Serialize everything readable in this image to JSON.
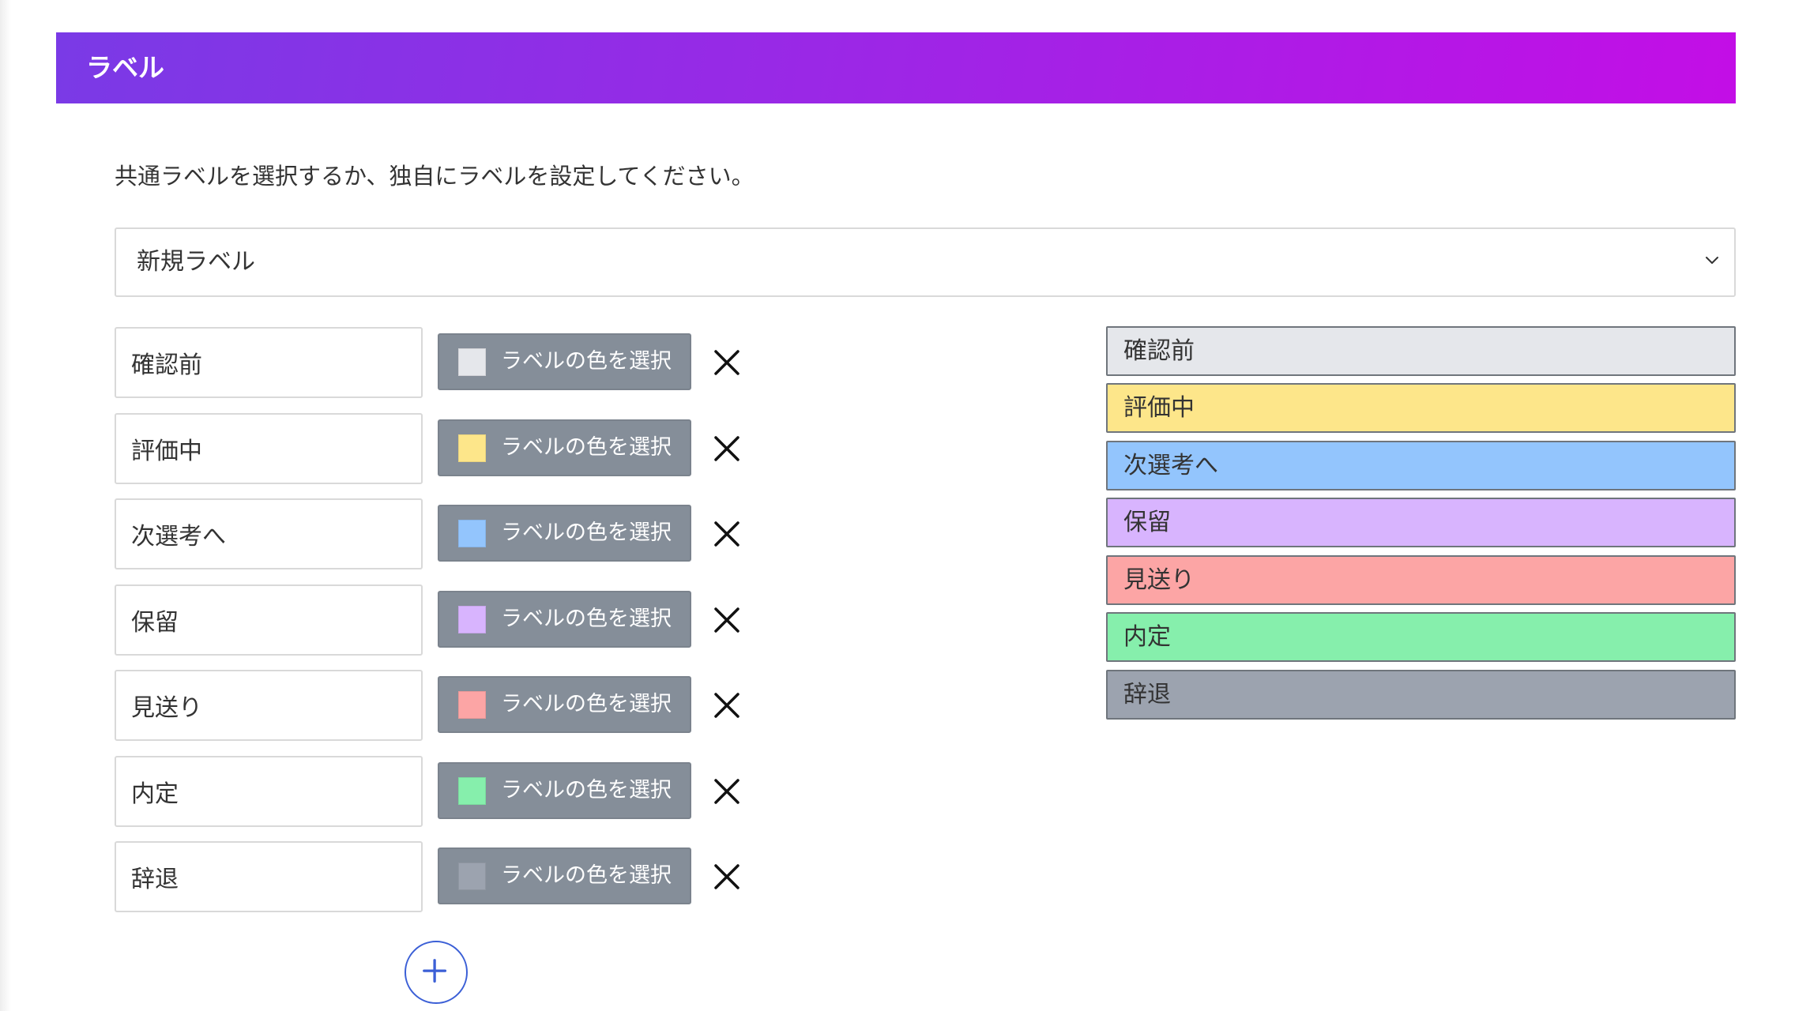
{
  "header": {
    "title": "ラベル"
  },
  "description": "共通ラベルを選択するか、独自にラベルを設定してください。",
  "preset_select": {
    "value": "新規ラベル"
  },
  "color_button_label": "ラベルの色を選択",
  "labels": [
    {
      "name": "確認前",
      "color": "#e5e7eb"
    },
    {
      "name": "評価中",
      "color": "#fde68a"
    },
    {
      "name": "次選考へ",
      "color": "#93c5fd"
    },
    {
      "name": "保留",
      "color": "#d8b4fe"
    },
    {
      "name": "見送り",
      "color": "#fca5a5"
    },
    {
      "name": "内定",
      "color": "#86efac"
    },
    {
      "name": "辞退",
      "color": "#9ca3af"
    }
  ],
  "icons": {
    "delete": "close-icon",
    "add": "plus-icon",
    "select": "chevron-down-icon"
  },
  "colors": {
    "header_start": "#7a3ae6",
    "header_end": "#c30ee6",
    "color_button_bg": "#858e99",
    "add_button_accent": "#3b5fd6"
  }
}
